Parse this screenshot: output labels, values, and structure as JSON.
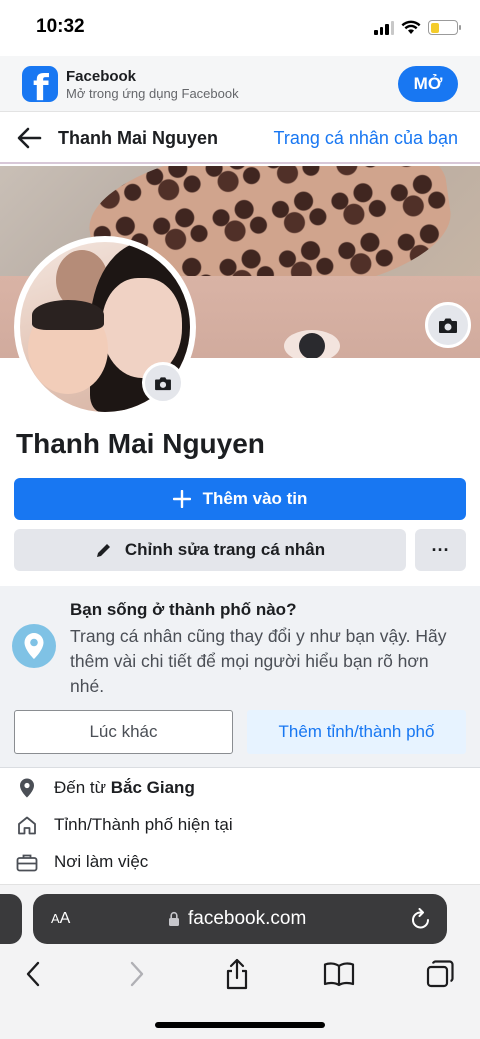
{
  "status_bar": {
    "time": "10:32",
    "battery_level": 0.35
  },
  "app_banner": {
    "title": "Facebook",
    "subtitle": "Mở trong ứng dụng Facebook",
    "open_label": "MỞ"
  },
  "header": {
    "name": "Thanh Mai Nguyen",
    "profile_link": "Trang cá nhân của bạn"
  },
  "profile": {
    "name": "Thanh Mai Nguyen",
    "add_story_label": "Thêm vào tin",
    "edit_profile_label": "Chỉnh sửa trang cá nhân",
    "more_label": "···"
  },
  "prompt": {
    "title": "Bạn sống ở thành phố nào?",
    "body": "Trang cá nhân cũng thay đổi y như bạn vậy. Hãy thêm vài chi tiết để mọi người hiểu bạn rõ hơn nhé.",
    "later_label": "Lúc khác",
    "add_city_label": "Thêm tỉnh/thành phố"
  },
  "info": {
    "from_prefix": "Đến từ",
    "from_value": "Bắc Giang",
    "current_city": "Tỉnh/Thành phố hiện tại",
    "workplace": "Nơi làm việc"
  },
  "safari": {
    "aa_big": "A",
    "aa_small": "A",
    "url": "facebook.com"
  },
  "colors": {
    "accent": "#1877f2",
    "button_gray": "#e4e6eb",
    "card_bg": "#f0f2f5"
  }
}
